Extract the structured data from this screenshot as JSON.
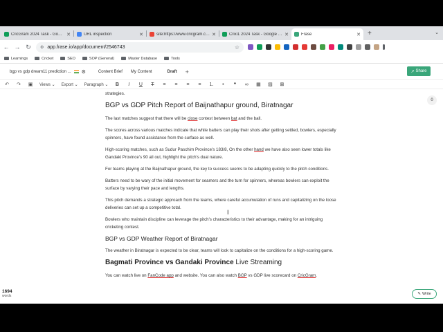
{
  "browser": {
    "tabs": [
      {
        "title": "CricGram 2024 Task - Google",
        "favicon_color": "#0f9d58"
      },
      {
        "title": "URL inspection",
        "favicon_color": "#4285f4"
      },
      {
        "title": "site:https://www.cricgram.com",
        "favicon_color": "#ea4335"
      },
      {
        "title": "Crixi1 2024 Task - Google Sh",
        "favicon_color": "#0f9d58"
      },
      {
        "title": "Frase",
        "favicon_color": "#3aa67a"
      }
    ],
    "url": "app.frase.io/app/document/2546743",
    "bookmarks": [
      "Learnings",
      "Cricket",
      "SEO",
      "SOP (General)",
      "Master Database",
      "Tools"
    ]
  },
  "app": {
    "doc_title": "bgp vs gdp dream11 prediction ...",
    "tabs": [
      "Content Brief",
      "My Content",
      "Draft"
    ],
    "share_label": "Share",
    "toolbar": {
      "views": "Views",
      "export": "Export",
      "paragraph": "Paragraph"
    },
    "comment_count": "0",
    "word_count": "1694",
    "word_count_label": "words",
    "write_label": "Write"
  },
  "content": {
    "p0": "strategies.",
    "h_pitch": "BGP vs GDP Pitch Report of Baijnathapur ground, Biratnagar",
    "p1a": "The last matches suggest that there will be ",
    "p1b": "close",
    "p1c": " contest between ",
    "p1d": "bat",
    "p1e": " and the ball.",
    "p2": "The scores across various matches indicate that while batters can play their shots after getting settled, bowlers, especially spinners, have found assistance from the surface as well.",
    "p3a": "High-scoring matches, such as Sudur Paschim Province's 183/8, On the other ",
    "p3b": "hand",
    "p3c": " we have also seen lower totals like Gandaki Province's 90 all out, highlight the pitch's dual nature.",
    "p4": "For teams playing at the Baijnathapur ground, the key to success seems to be adapting quickly to the pitch conditions.",
    "p5": "Batters need to be wary of the initial movement for seamers and the turn for spinners, whereas bowlers can exploit the surface by varying their pace and lengths.",
    "p6": "This pitch demands a strategic approach from the teams, where careful accumulation of runs and capitalizing on the loose deliveries can set up a competitive total.",
    "p7": "Bowlers who maintain discipline can leverage the pitch's characteristics to their advantage, making for an intriguing cricketing contest.",
    "h_weather": "BGP vs GDP Weather Report of Biratnagar",
    "p8": "The weather in Biratnagar is expected to be clear, teams will look to capitalize on the conditions for a high-scoring game.",
    "h_live_a": "Bagmati Province vs Gandaki Province",
    "h_live_b": " Live Streaming",
    "p9a": "You can watch live on ",
    "p9b": "FanCode app",
    "p9c": " and website. You can also watch ",
    "p9d": "BGP",
    "p9e": " vs GDP live scorecard on ",
    "p9f": "CricGram",
    "p9g": "."
  }
}
